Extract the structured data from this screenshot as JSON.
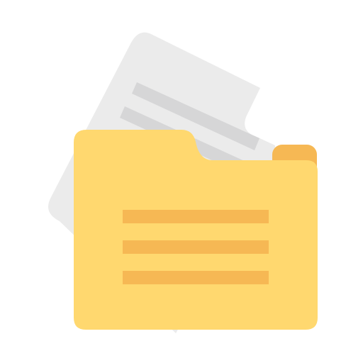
{
  "icon": {
    "name": "folder-with-document-icon",
    "colors": {
      "background": "#ffffff",
      "document_paper": "#ebebeb",
      "document_lines": "#d6d6d7",
      "folder_back": "#f6b854",
      "folder_front": "#ffd86f",
      "folder_lines": "#f6b854"
    }
  }
}
